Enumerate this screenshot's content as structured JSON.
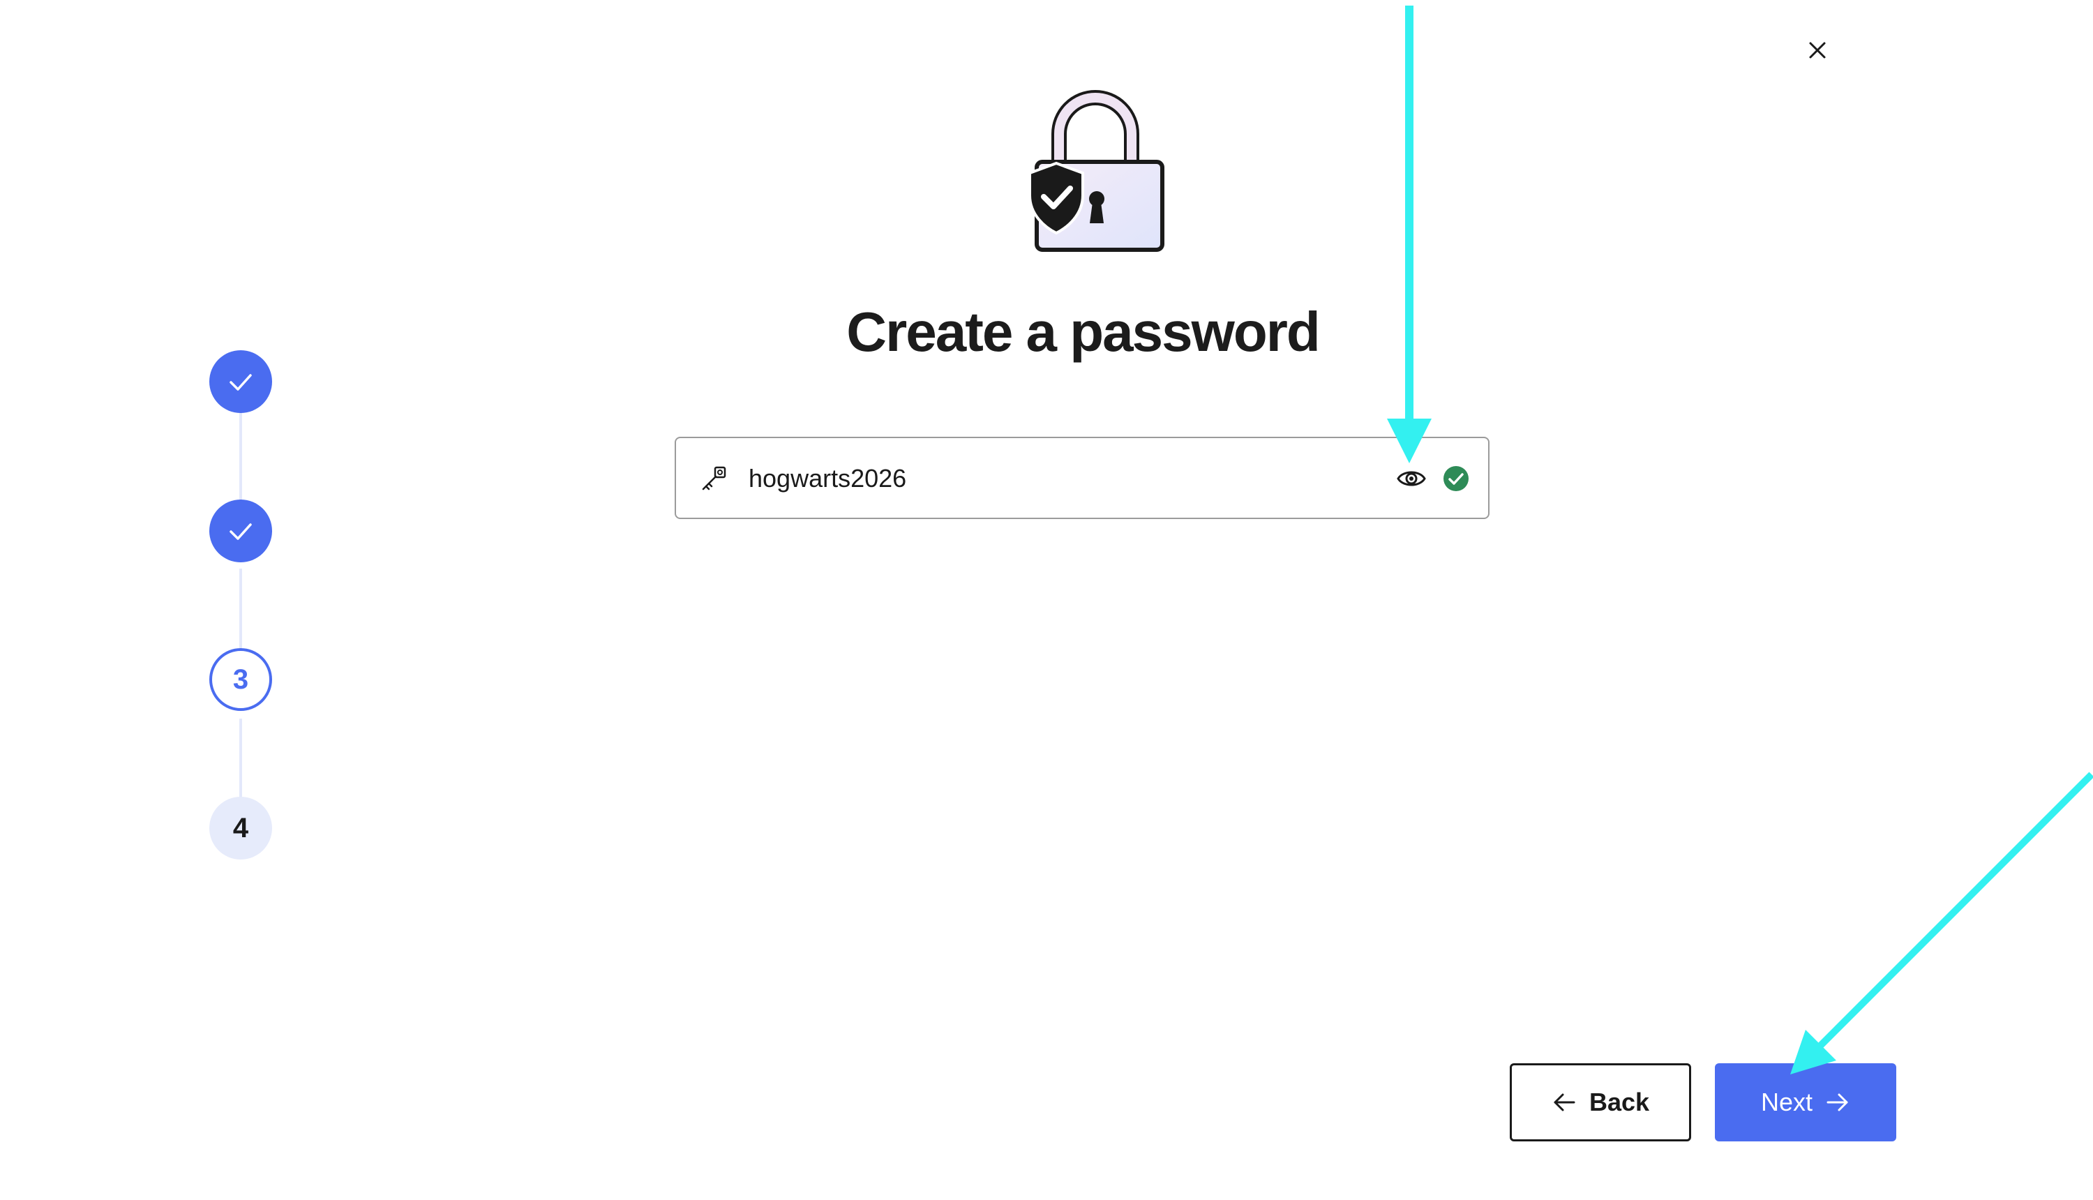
{
  "dialog": {
    "close_label": "×",
    "title": "Create a password"
  },
  "stepper": {
    "steps": [
      {
        "state": "done",
        "label": ""
      },
      {
        "state": "done",
        "label": ""
      },
      {
        "state": "current",
        "label": "3"
      },
      {
        "state": "future",
        "label": "4"
      }
    ]
  },
  "password_field": {
    "value": "hogwarts2026",
    "icon": "key-icon",
    "toggle_icon": "eye-icon",
    "status_icon": "check-circle-icon"
  },
  "buttons": {
    "back_label": "Back",
    "next_label": "Next"
  },
  "colors": {
    "accent": "#4a6cf0",
    "valid": "#2e8b57",
    "annotation": "#33f0f0"
  }
}
